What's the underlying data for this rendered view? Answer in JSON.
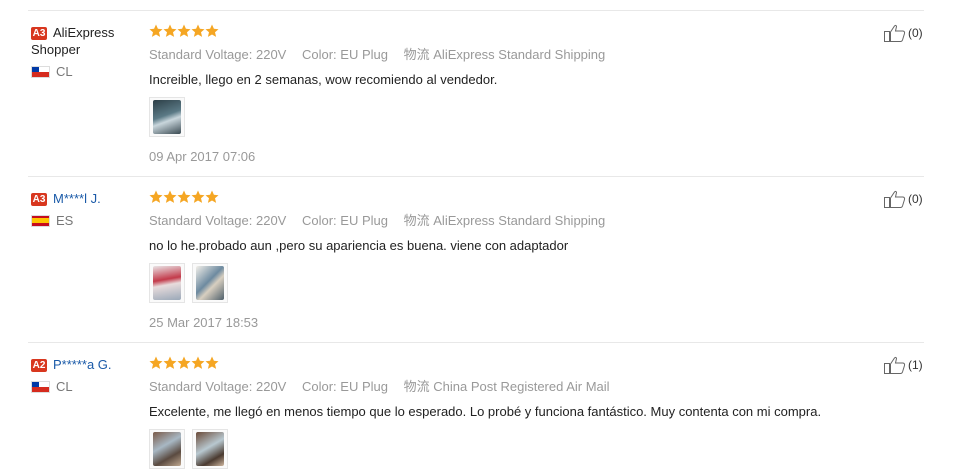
{
  "attr_labels": {
    "voltage": "Standard Voltage:",
    "color": "Color:",
    "shipping": "物流"
  },
  "reviews": [
    {
      "level": "A3",
      "name_line1": "AliExpress",
      "name_line2": "Shopper",
      "country": "CL",
      "voltage": "220V",
      "color": "EU Plug",
      "shipping": "AliExpress Standard Shipping",
      "text": "Increible, llego en 2 semanas, wow recomiendo al vendedor.",
      "date": "09 Apr 2017 07:06",
      "helpful": "(0)",
      "rating": 5,
      "photo_count": 1
    },
    {
      "level": "A3",
      "name_line1": "M****l J.",
      "country": "ES",
      "voltage": "220V",
      "color": "EU Plug",
      "shipping": "AliExpress Standard Shipping",
      "text": "no lo he.probado aun ,pero su apariencia es buena. viene con adaptador",
      "date": "25 Mar 2017 18:53",
      "helpful": "(0)",
      "rating": 5,
      "photo_count": 2
    },
    {
      "level": "A2",
      "name_line1": "P*****a G.",
      "country": "CL",
      "voltage": "220V",
      "color": "EU Plug",
      "shipping": "China Post Registered Air Mail",
      "text": "Excelente, me llegó en menos tiempo que lo esperado. Lo probé y funciona fantástico. Muy contenta con mi compra.",
      "helpful": "(1)",
      "rating": 5,
      "photo_count": 2
    }
  ],
  "colors": {
    "star": "#f5a623",
    "level_badge": "#d8371f",
    "user_link": "#1a5aa8"
  },
  "icons": {
    "star": "star-icon",
    "helpful": "thumbs-up-icon"
  }
}
